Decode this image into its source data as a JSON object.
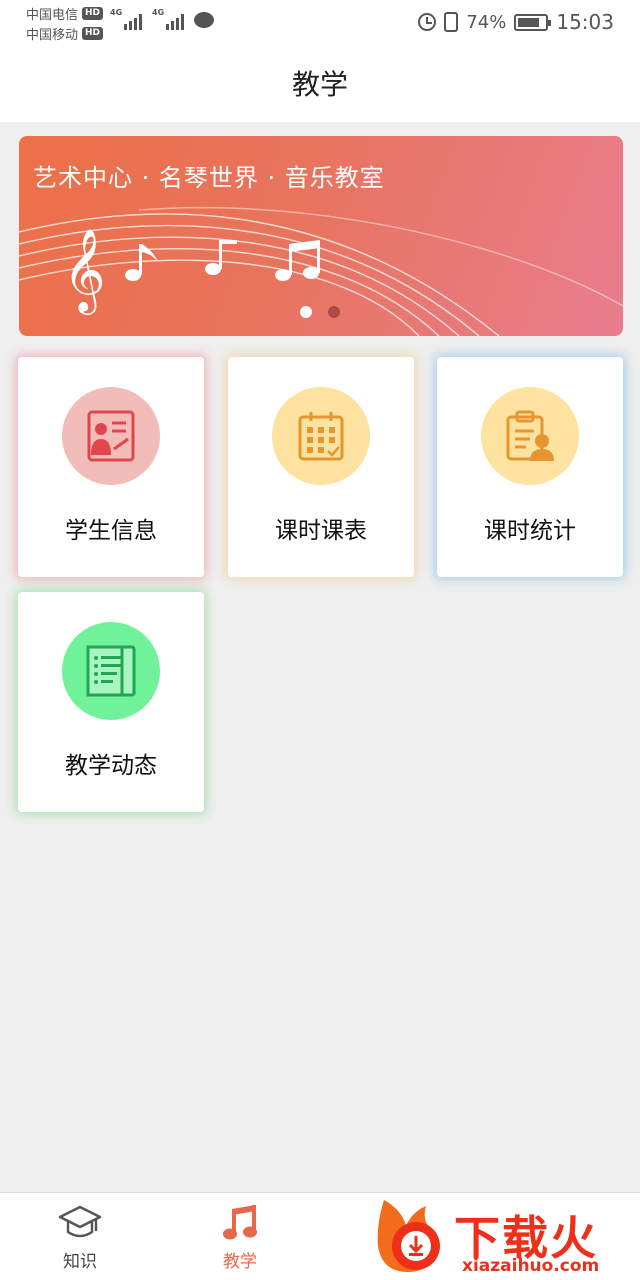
{
  "status_bar": {
    "carrier_1": "中国电信",
    "carrier_2": "中国移动",
    "hd_badge": "HD",
    "network_1": "4G",
    "network_2": "4G",
    "battery_percent": "74%",
    "time": "15:03"
  },
  "header": {
    "title": "教学"
  },
  "banner": {
    "text": "艺术中心 · 名琴世界 · 音乐教室",
    "slide_count": 2,
    "active_slide": 1
  },
  "cards": [
    {
      "label": "学生信息",
      "icon": "student-info-icon",
      "circle_color": "#f2bcb8",
      "icon_color": "#e0474c"
    },
    {
      "label": "课时课表",
      "icon": "calendar-icon",
      "circle_color": "#fde2a0",
      "icon_color": "#e7952f"
    },
    {
      "label": "课时统计",
      "icon": "clipboard-person-icon",
      "circle_color": "#fde2a0",
      "icon_color": "#e7952f"
    },
    {
      "label": "教学动态",
      "icon": "document-list-icon",
      "circle_color": "#70f29b",
      "icon_color": "#1fa64e"
    }
  ],
  "bottom_nav": {
    "items": [
      {
        "label": "知识",
        "icon": "graduation-cap-icon",
        "active": false
      },
      {
        "label": "教学",
        "icon": "music-note-icon",
        "active": true
      }
    ]
  },
  "watermark": {
    "text": "下载火",
    "url": "xiazaihuo.com"
  },
  "colors": {
    "accent": "#e8664a",
    "background": "#efefef"
  }
}
